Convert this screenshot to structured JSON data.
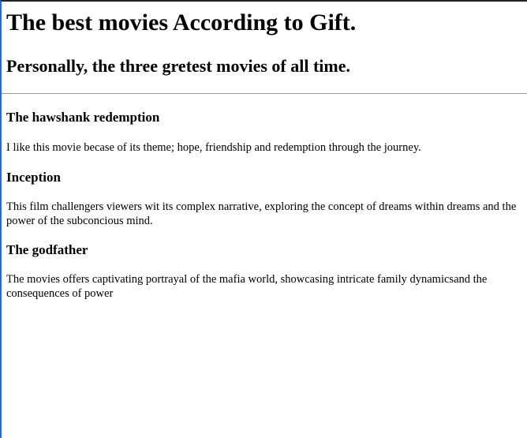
{
  "page": {
    "title": "The best movies According to Gift.",
    "subtitle": "Personally, the three gretest movies of all time."
  },
  "movies": [
    {
      "title": "The hawshank redemption",
      "description": "I like this movie becase of its theme; hope, friendship and redemption through the journey."
    },
    {
      "title": "Inception",
      "description": "This film challengers viewers wit its complex narrative, exploring the concept of dreams within dreams and the power of the subconcious mind."
    },
    {
      "title": "The godfather",
      "description": "The movies offers captivating portrayal of the mafia world, showcasing intricate family dynamicsand the consequences of power"
    }
  ],
  "colors": {
    "left_border": "#1a6fd1",
    "top_border": "#222222",
    "divider": "#9a9a9a"
  }
}
